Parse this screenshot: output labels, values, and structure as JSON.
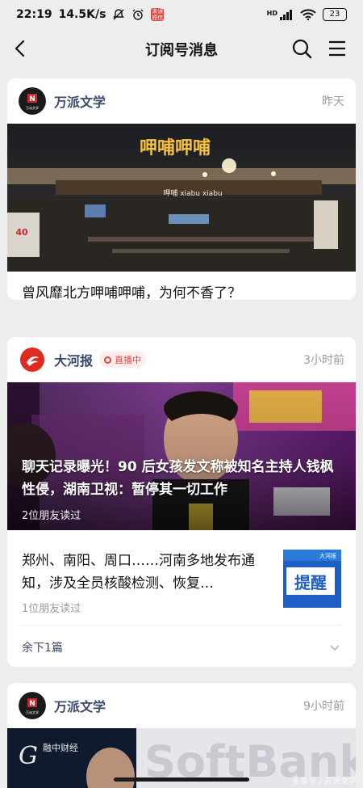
{
  "status_bar": {
    "time": "22:19",
    "net_speed": "14.5K/s",
    "badge_text": "未读 短信",
    "network_label": "HD",
    "battery": "23"
  },
  "nav": {
    "title": "订阅号消息"
  },
  "cards": [
    {
      "source": "万派文学",
      "avatar_text": "万派文学",
      "time": "昨天",
      "hero_sign": "呷哺呷哺",
      "hero_sign_small": "呷哺 xiabu xiabu",
      "hero_price": "40",
      "headline": "曾风靡北方呷哺呷哺，为何不香了？"
    },
    {
      "source": "大河报",
      "live_label": "直播中",
      "time": "3小时前",
      "hero_title": "聊天记录曝光！90 后女孩发文称被知名主持人钱枫性侵，湖南卫视：暂停其一切工作",
      "hero_read": "2位朋友读过",
      "sub_title": "郑州、南阳、周口……河南多地发布通知，涉及全员核酸检测、恢复…",
      "sub_read": "1位朋友读过",
      "sub_thumb_text": "提醒",
      "sub_thumb_small": "大河报",
      "more_label": "余下1篇"
    },
    {
      "source": "万派文学",
      "avatar_text": "万派文学",
      "time": "9小时前",
      "hero_brand": "融中财经",
      "hero_brand_letter": "G"
    }
  ],
  "watermark": "头条号 / 万派文学",
  "colors": {
    "background": "#ededed",
    "card": "#ffffff",
    "source_text": "#3a4a6e",
    "live_red": "#e0483f",
    "muted": "#9a9a9a"
  }
}
